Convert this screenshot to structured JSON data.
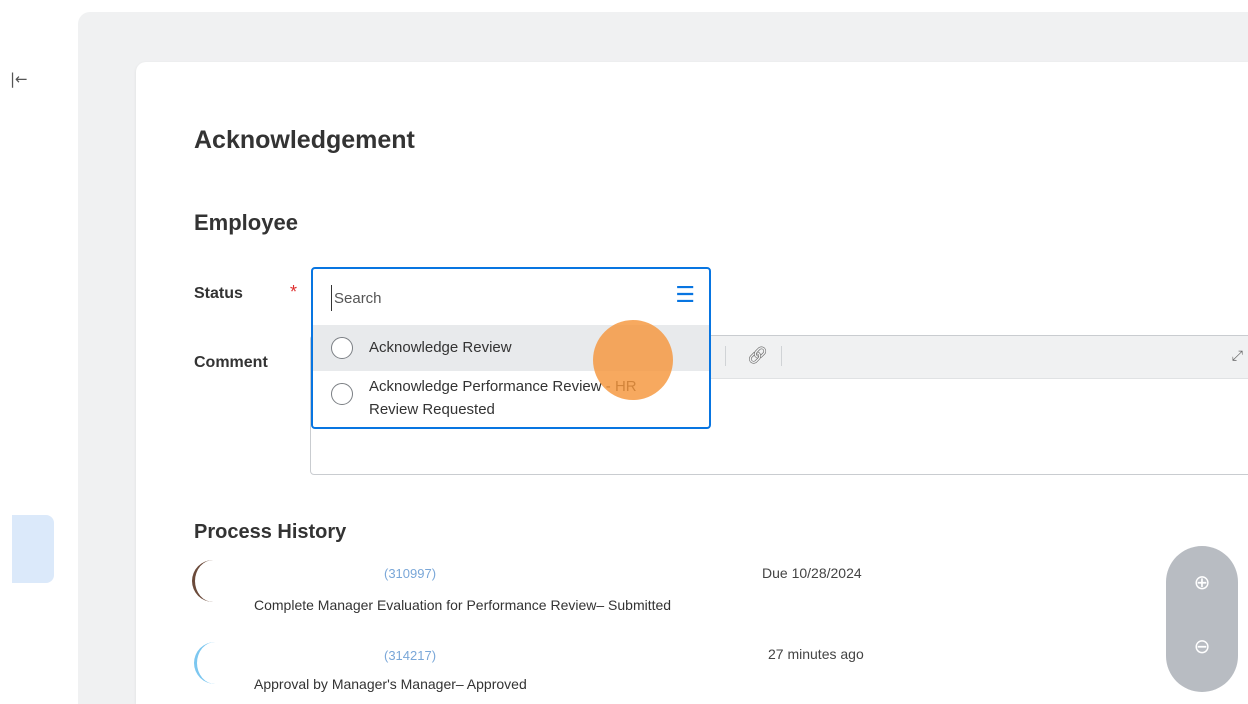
{
  "nav": {
    "collapse_icon": "collapse-left-icon",
    "collapse_glyph": "|←"
  },
  "page": {
    "title": "Acknowledgement",
    "section": "Employee"
  },
  "form": {
    "status_label": "Status",
    "required_mark": "*",
    "comment_label": "Comment",
    "search_placeholder": "Search",
    "options": [
      {
        "label": "Acknowledge Review"
      },
      {
        "label_line1": "Acknowledge Performance Review - HR",
        "label_line2": "Review Requested"
      }
    ]
  },
  "history": {
    "title": "Process History",
    "items": [
      {
        "person": "(310997)",
        "description": "Complete Manager Evaluation for Performance Review– Submitted",
        "time": "Due 10/28/2024"
      },
      {
        "person": "(314217)",
        "description": "Approval by Manager's Manager– Approved",
        "time": "27 minutes ago"
      }
    ]
  },
  "zoom": {
    "in_icon": "zoom-in-icon",
    "out_icon": "zoom-out-icon"
  },
  "colors": {
    "accent": "#0875e1",
    "required": "#de2d2d",
    "cursor": "#f5963c"
  }
}
